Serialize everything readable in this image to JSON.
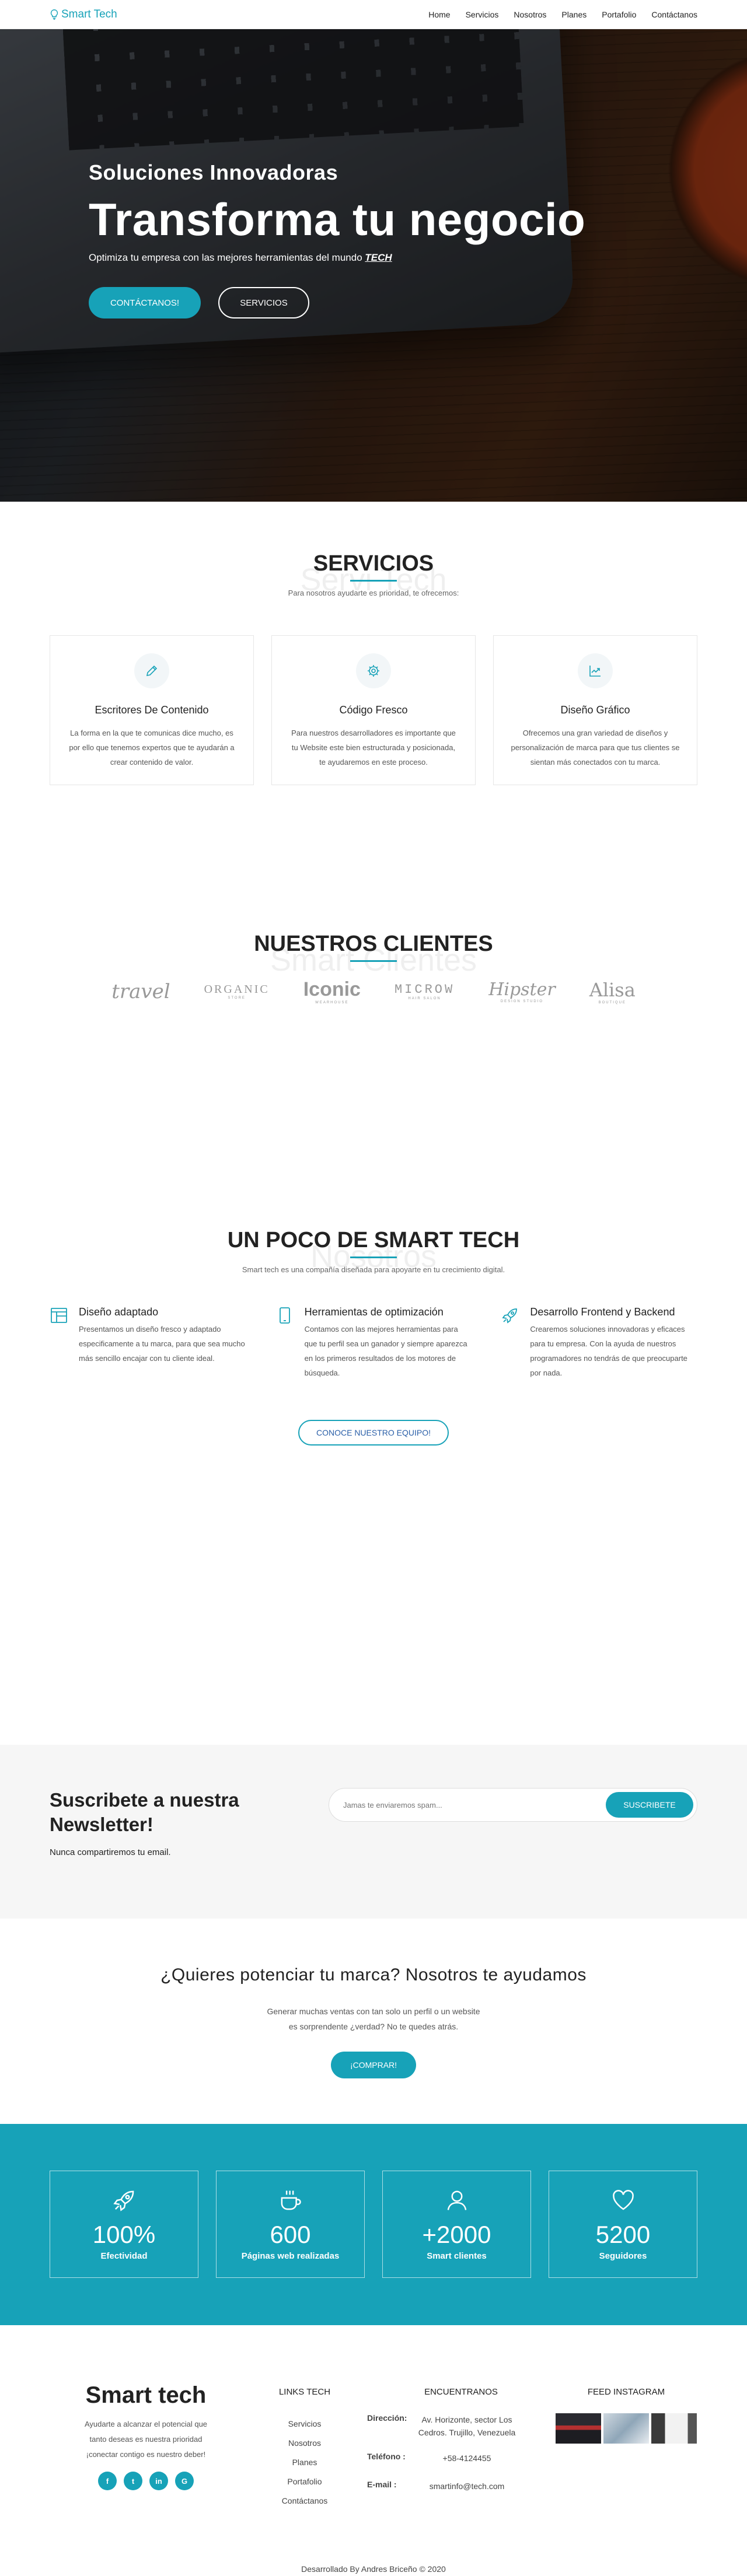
{
  "nav": {
    "brand": "Smart Tech",
    "links": [
      "Home",
      "Servicios",
      "Nosotros",
      "Planes",
      "Portafolio",
      "Contáctanos"
    ]
  },
  "hero": {
    "subtitle": "Soluciones Innovadoras",
    "title": "Transforma tu negocio",
    "text_prefix": "Optimiza tu empresa con las mejores herramientas del mundo ",
    "text_emphasis": "TECH",
    "primary_btn": "CONTÁCTANOS!",
    "secondary_btn": "SERVICIOS"
  },
  "services": {
    "title": "SERVICIOS",
    "ghost": "Servi Tech",
    "desc": "Para nosotros ayudarte es prioridad, te ofrecemos:",
    "cards": [
      {
        "icon": "pencil-icon",
        "title": "Escritores De Contenido",
        "text": "La forma en la que te comunicas dice mucho, es por ello que tenemos expertos que te ayudarán a crear contenido de valor."
      },
      {
        "icon": "gear-icon",
        "title": "Código Fresco",
        "text": "Para nuestros desarrolladores es importante que tu Website este bien estructurada y posicionada, te ayudaremos en este proceso."
      },
      {
        "icon": "chart-line-icon",
        "title": "Diseño Gráfico",
        "text": "Ofrecemos una gran variedad de diseños y personalización de marca para que tus clientes se sientan más conectados con tu marca."
      }
    ]
  },
  "clients": {
    "title": "NUESTROS CLIENTES",
    "ghost": "Smart Clientes",
    "logos": [
      {
        "big": "travel",
        "small": ""
      },
      {
        "big": "ORGANIC",
        "small": "STORE"
      },
      {
        "big": "Iconic",
        "small": "WEARHOUSE"
      },
      {
        "big": "MICROW",
        "small": "HAIR SALON"
      },
      {
        "big": "Hipster",
        "small": "DESIGN STUDIO"
      },
      {
        "big": "Alisa",
        "small": "BOUTIQUE"
      }
    ]
  },
  "about": {
    "title": "UN POCO DE SMART TECH",
    "ghost": "Nosotros",
    "desc": "Smart tech es una compañía diseñada para apoyarte en tu crecimiento digital.",
    "features": [
      {
        "icon": "layout-icon",
        "title": "Diseño adaptado",
        "text": "Presentamos un diseño fresco y adaptado especificamente a tu marca, para que sea mucho más sencillo encajar con tu cliente ideal."
      },
      {
        "icon": "mobile-icon",
        "title": "Herramientas de optimización",
        "text": "Contamos con las mejores herramientas para que tu perfil sea un ganador y siempre aparezca en los primeros resultados de los motores de búsqueda."
      },
      {
        "icon": "rocket-icon",
        "title": "Desarrollo Frontend y Backend",
        "text": "Crearemos soluciones innovadoras y eficaces para tu empresa. Con la ayuda de nuestros programadores no tendrás de que preocuparte por nada."
      }
    ],
    "button": "CONOCE NUESTRO EQUIPO!"
  },
  "newsletter": {
    "title": "Suscribete a nuestra Newsletter!",
    "note": "Nunca compartiremos tu email.",
    "placeholder": "Jamas te enviaremos spam...",
    "button": "SUSCRIBETE"
  },
  "cta": {
    "title": "¿Quieres potenciar tu marca? Nosotros te ayudamos",
    "line1": "Generar muchas ventas con tan solo un perfil o un website",
    "line2": "es sorprendente ¿verdad? No te quedes atrás.",
    "button": "¡COMPRAR!"
  },
  "stats": [
    {
      "icon": "rocket-icon",
      "value": "100%",
      "label": "Efectividad"
    },
    {
      "icon": "coffee-icon",
      "value": "600",
      "label": "Páginas web realizadas"
    },
    {
      "icon": "user-icon",
      "value": "+2000",
      "label": "Smart clientes"
    },
    {
      "icon": "heart-icon",
      "value": "5200",
      "label": "Seguidores"
    }
  ],
  "footer": {
    "brand": "Smart tech",
    "tagline": [
      "Ayudarte a alcanzar el potencial que",
      "tanto deseas es nuestra prioridad",
      "¡conectar contigo es nuestro deber!"
    ],
    "socials": [
      "f",
      "t",
      "in",
      "G"
    ],
    "links_title": "LINKS TECH",
    "links": [
      "Servicios",
      "Nosotros",
      "Planes",
      "Portafolio",
      "Contáctanos"
    ],
    "contact_title": "ENCUENTRANOS",
    "address_label": "Dirección:",
    "address": "Av. Horizonte, sector Los Cedros. Trujillo, Venezuela",
    "phone_label": "Teléfono :",
    "phone": "+58-4124455",
    "email_label": "E-mail :",
    "email": "smartinfo@tech.com",
    "insta_title": "FEED INSTAGRAM",
    "copyright": "Desarrollado By Andres Briceño © 2020"
  },
  "colors": {
    "accent": "#17a2b8"
  }
}
